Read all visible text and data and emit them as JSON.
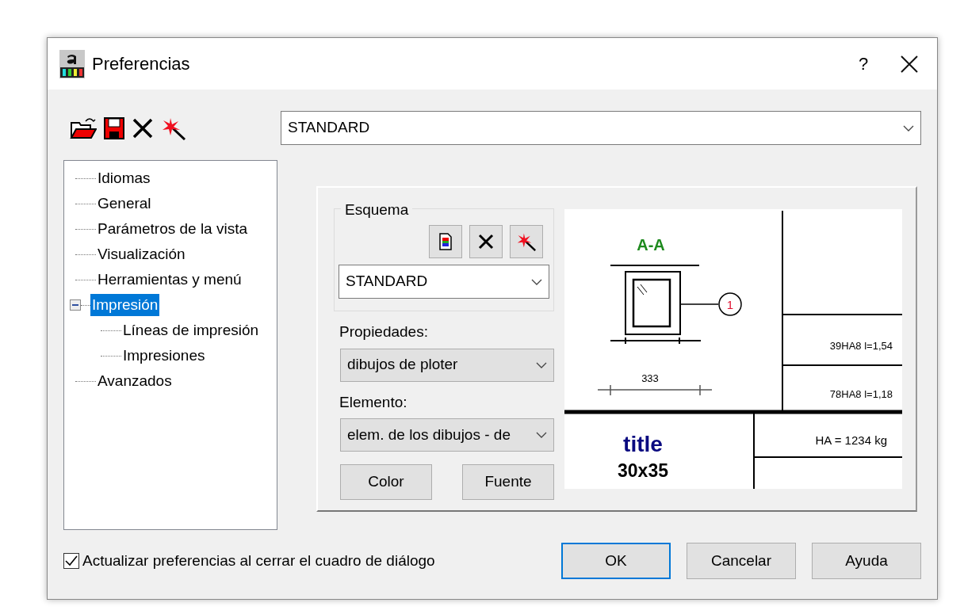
{
  "window": {
    "title": "Preferencias",
    "help_button": "?"
  },
  "profile_select": {
    "value": "STANDARD"
  },
  "tree": [
    {
      "label": "Idiomas",
      "selected": false
    },
    {
      "label": "General",
      "selected": false
    },
    {
      "label": "Parámetros de la vista",
      "selected": false
    },
    {
      "label": "Visualización",
      "selected": false
    },
    {
      "label": "Herramientas y menú",
      "selected": false
    },
    {
      "label": "Impresión",
      "selected": true,
      "expanded": true,
      "children": [
        {
          "label": "Líneas de impresión",
          "selected": false
        },
        {
          "label": "Impresiones",
          "selected": false
        }
      ]
    },
    {
      "label": "Avanzados",
      "selected": false
    }
  ],
  "scheme": {
    "label": "Esquema",
    "value": "STANDARD"
  },
  "properties": {
    "label": "Propiedades:",
    "value": "dibujos de ploter"
  },
  "element": {
    "label": "Elemento:",
    "value": "elem. de los dibujos - de"
  },
  "style_buttons": [
    "Color",
    "Fuente"
  ],
  "preview": {
    "section_label": "A-A",
    "bar_mark": "1",
    "dimension": "333",
    "rebar_lines": [
      "39HA8 l=1,54",
      "78HA8 l=1,18"
    ],
    "weight": "HA = 1234 kg",
    "title": "title",
    "size": "30x35"
  },
  "update_checkbox": {
    "label": "Actualizar preferencias al cerrar el cuadro de diálogo",
    "checked": true
  },
  "dialog_buttons": [
    {
      "label": "OK",
      "default": true
    },
    {
      "label": "Cancelar",
      "default": false
    },
    {
      "label": "Ayuda",
      "default": false
    }
  ]
}
